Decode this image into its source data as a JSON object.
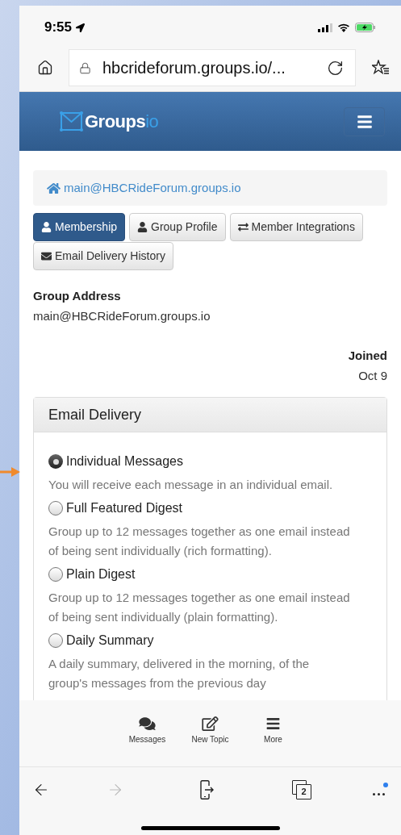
{
  "status_bar": {
    "time": "9:55"
  },
  "browser": {
    "url": "hbcrideforum.groups.io/..."
  },
  "site_header": {
    "logo_word": "Groups",
    "logo_suffix": "io"
  },
  "breadcrumb": {
    "label": "main@HBCRideForum.groups.io"
  },
  "tabs": [
    {
      "label": "Membership",
      "selected": true
    },
    {
      "label": "Group Profile",
      "selected": false
    },
    {
      "label": "Member Integrations",
      "selected": false
    },
    {
      "label": "Email Delivery History",
      "selected": false
    }
  ],
  "group_address": {
    "label": "Group Address",
    "value": "main@HBCRideForum.groups.io"
  },
  "joined": {
    "label": "Joined",
    "value": "Oct 9"
  },
  "email_delivery": {
    "title": "Email Delivery",
    "options": [
      {
        "label": "Individual Messages",
        "description": "You will receive each message in an individual email.",
        "selected": true
      },
      {
        "label": "Full Featured Digest",
        "description": "Group up to 12 messages together as one email instead of being sent individually (rich formatting).",
        "selected": false
      },
      {
        "label": "Plain Digest",
        "description": "Group up to 12 messages together as one email instead of being sent individually (plain formatting).",
        "selected": false
      },
      {
        "label": "Daily Summary",
        "description": "A daily summary, delivered in the morning, of the group's messages from the previous day",
        "selected": false
      }
    ]
  },
  "bottom_nav": [
    {
      "label": "Messages"
    },
    {
      "label": "New Topic"
    },
    {
      "label": "More"
    }
  ],
  "browser_toolbar": {
    "forward_disabled": true,
    "tab_count": "2"
  }
}
